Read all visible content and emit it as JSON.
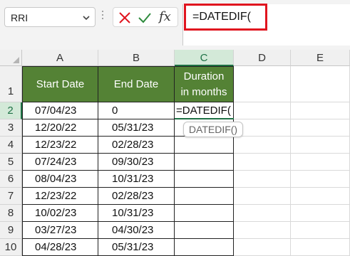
{
  "formula_bar": {
    "name_box": "RRI",
    "cancel_icon": "x-icon",
    "enter_icon": "check-icon",
    "fx_label": "fx",
    "formula": "=DATEDIF("
  },
  "columns": [
    "A",
    "B",
    "C",
    "D",
    "E"
  ],
  "rows": [
    "1",
    "2",
    "3",
    "4",
    "5",
    "6",
    "7",
    "8",
    "9",
    "10"
  ],
  "table": {
    "headers": {
      "start": "Start Date",
      "end": "End Date",
      "duration_line1": "Duration",
      "duration_line2": "in months"
    },
    "data": [
      {
        "start": "07/04/23",
        "end": "0",
        "duration": "=DATEDIF("
      },
      {
        "start": "12/20/22",
        "end": "05/31/23",
        "duration": ""
      },
      {
        "start": "12/23/22",
        "end": "02/28/23",
        "duration": ""
      },
      {
        "start": "07/24/23",
        "end": "09/30/23",
        "duration": ""
      },
      {
        "start": "08/04/23",
        "end": "10/31/23",
        "duration": ""
      },
      {
        "start": "12/23/22",
        "end": "02/28/23",
        "duration": ""
      },
      {
        "start": "10/02/23",
        "end": "10/31/23",
        "duration": ""
      },
      {
        "start": "03/27/23",
        "end": "04/30/23",
        "duration": ""
      },
      {
        "start": "04/28/23",
        "end": "05/31/23",
        "duration": ""
      }
    ]
  },
  "tooltip": "DATEDIF()",
  "colors": {
    "header_fill": "#548235",
    "selection": "#1e7145",
    "highlight": "#e0141e"
  }
}
